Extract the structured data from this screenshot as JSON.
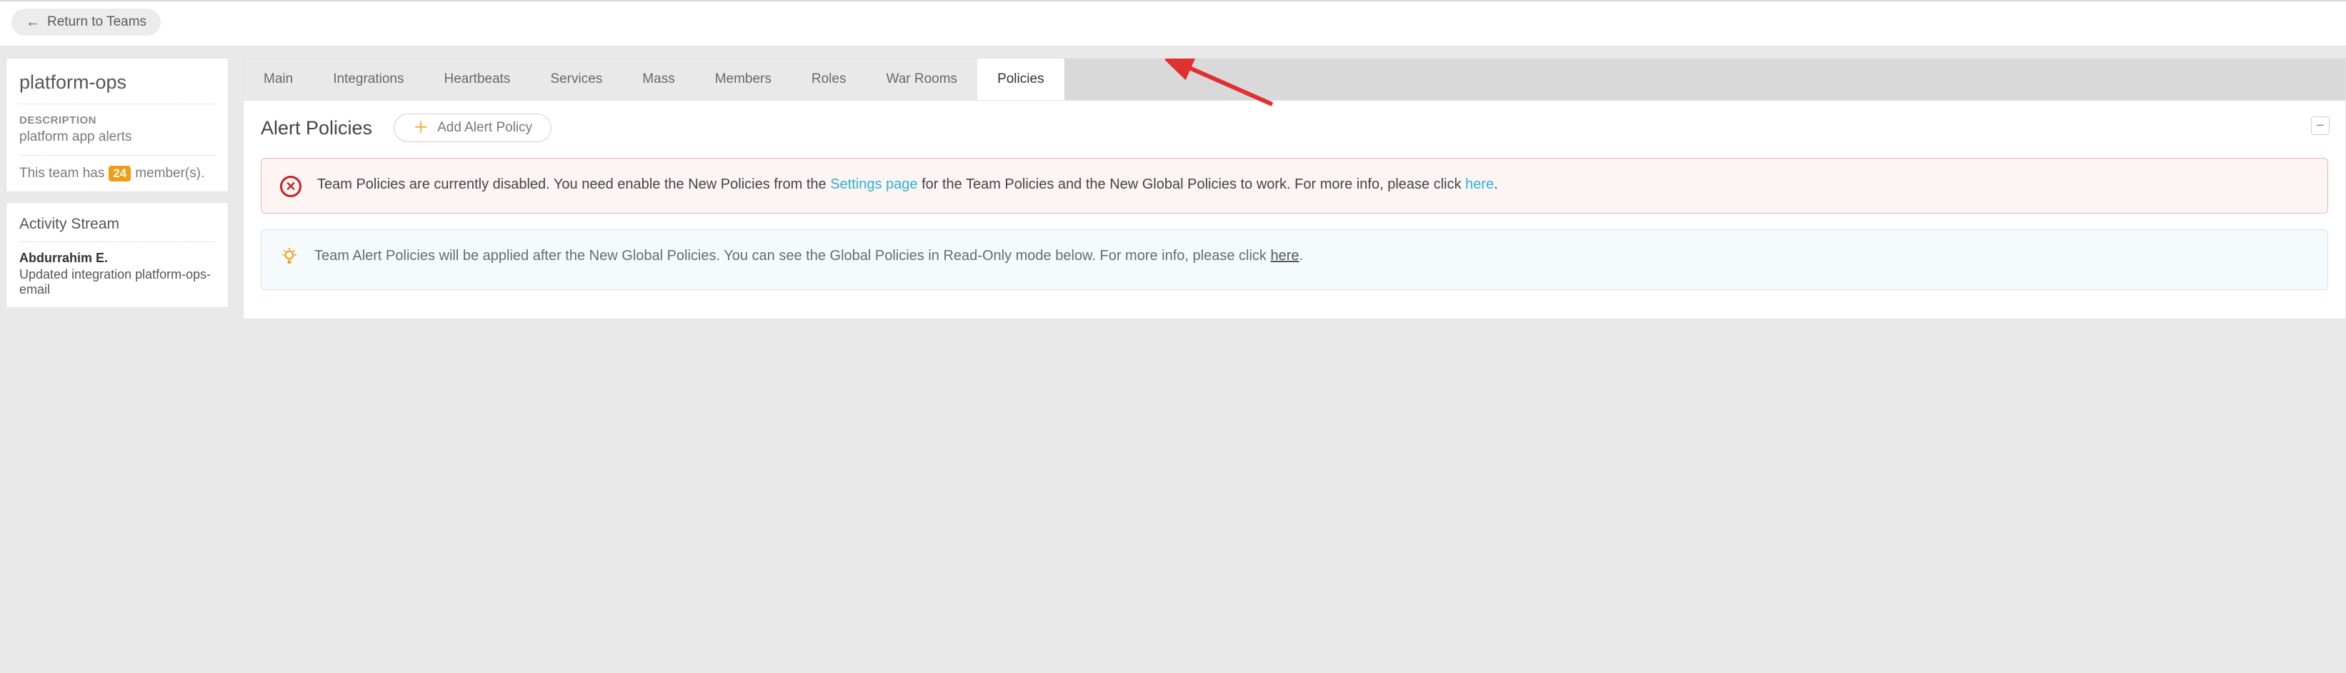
{
  "topbar": {
    "return_label": "Return to Teams"
  },
  "sidebar": {
    "team_name": "platform-ops",
    "description_label": "DESCRIPTION",
    "description_value": "platform app alerts",
    "members_prefix": "This team has",
    "members_count": "24",
    "members_suffix": "member(s).",
    "activity_title": "Activity Stream",
    "activity": [
      {
        "user": "Abdurrahim E.",
        "desc": "Updated integration platform-ops-email"
      }
    ]
  },
  "tabs": {
    "items": [
      "Main",
      "Integrations",
      "Heartbeats",
      "Services",
      "Mass",
      "Members",
      "Roles",
      "War Rooms",
      "Policies"
    ],
    "active_index": 8
  },
  "panel": {
    "title": "Alert Policies",
    "add_button_label": "Add Alert Policy",
    "collapse_glyph": "−"
  },
  "alerts": {
    "error": {
      "text_before_link": "Team Policies are currently disabled. You need enable the New Policies from the ",
      "link1": "Settings page",
      "text_mid": " for the Team Policies and the New Global Policies to work. For more info, please click ",
      "link2": "here",
      "text_after": "."
    },
    "info": {
      "text_before_link": "Team Alert Policies will be applied after the New Global Policies. You can see the Global Policies in Read-Only mode below. For more info, please click ",
      "link": "here",
      "text_after": "."
    }
  }
}
